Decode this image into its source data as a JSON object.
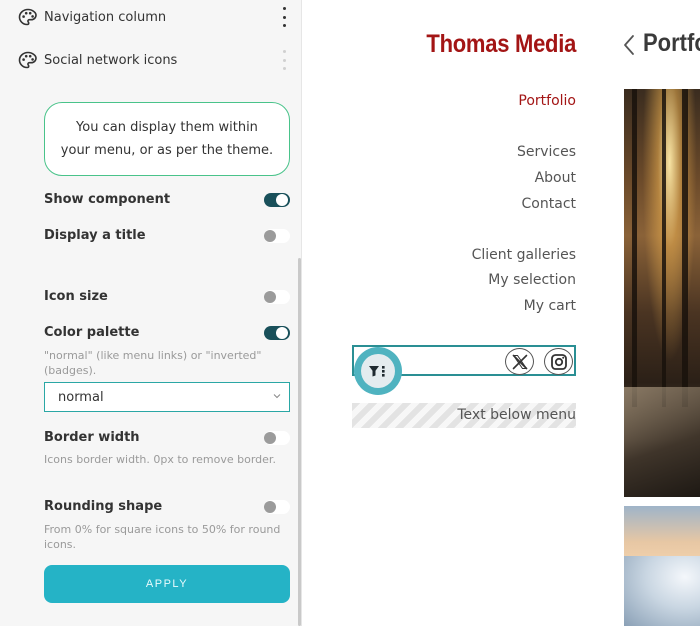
{
  "panel": {
    "top_items": [
      {
        "label": "Navigation column",
        "icon": "palette-icon"
      },
      {
        "label": "Social network icons",
        "icon": "palette-icon"
      }
    ],
    "info_line1": "You can display them within",
    "info_line2": "your menu, or as per the theme.",
    "options": {
      "show_component": {
        "label": "Show component",
        "on": true
      },
      "display_title": {
        "label": "Display a title",
        "on": false
      },
      "icon_size": {
        "label": "Icon size",
        "on": false
      },
      "color_palette": {
        "label": "Color palette",
        "on": true,
        "help": "\"normal\" (like menu links) or \"inverted\" (badges).",
        "select_value": "normal"
      },
      "border_width": {
        "label": "Border width",
        "on": false,
        "help": "Icons border width. 0px to remove border."
      },
      "rounding_shape": {
        "label": "Rounding shape",
        "on": false,
        "help": "From 0% for square icons to 50% for round icons."
      }
    },
    "apply_label": "APPLY"
  },
  "site": {
    "title": "Thomas Media",
    "menu": [
      {
        "label": "Portfolio",
        "active": true
      },
      {
        "label": "Services",
        "active": false
      },
      {
        "label": "About",
        "active": false
      },
      {
        "label": "Contact",
        "active": false
      },
      {
        "label": "Client galleries",
        "active": false
      },
      {
        "label": "My selection",
        "active": false
      },
      {
        "label": "My cart",
        "active": false
      }
    ],
    "social_icons": [
      "x-icon",
      "instagram-icon"
    ],
    "text_below_menu": "Text below menu"
  },
  "content": {
    "heading": "Portfolio"
  },
  "colors": {
    "accent_teal": "#25b3c6",
    "toggle_on": "#19505a",
    "brand_red": "#a31515",
    "info_border": "#49c38a"
  }
}
